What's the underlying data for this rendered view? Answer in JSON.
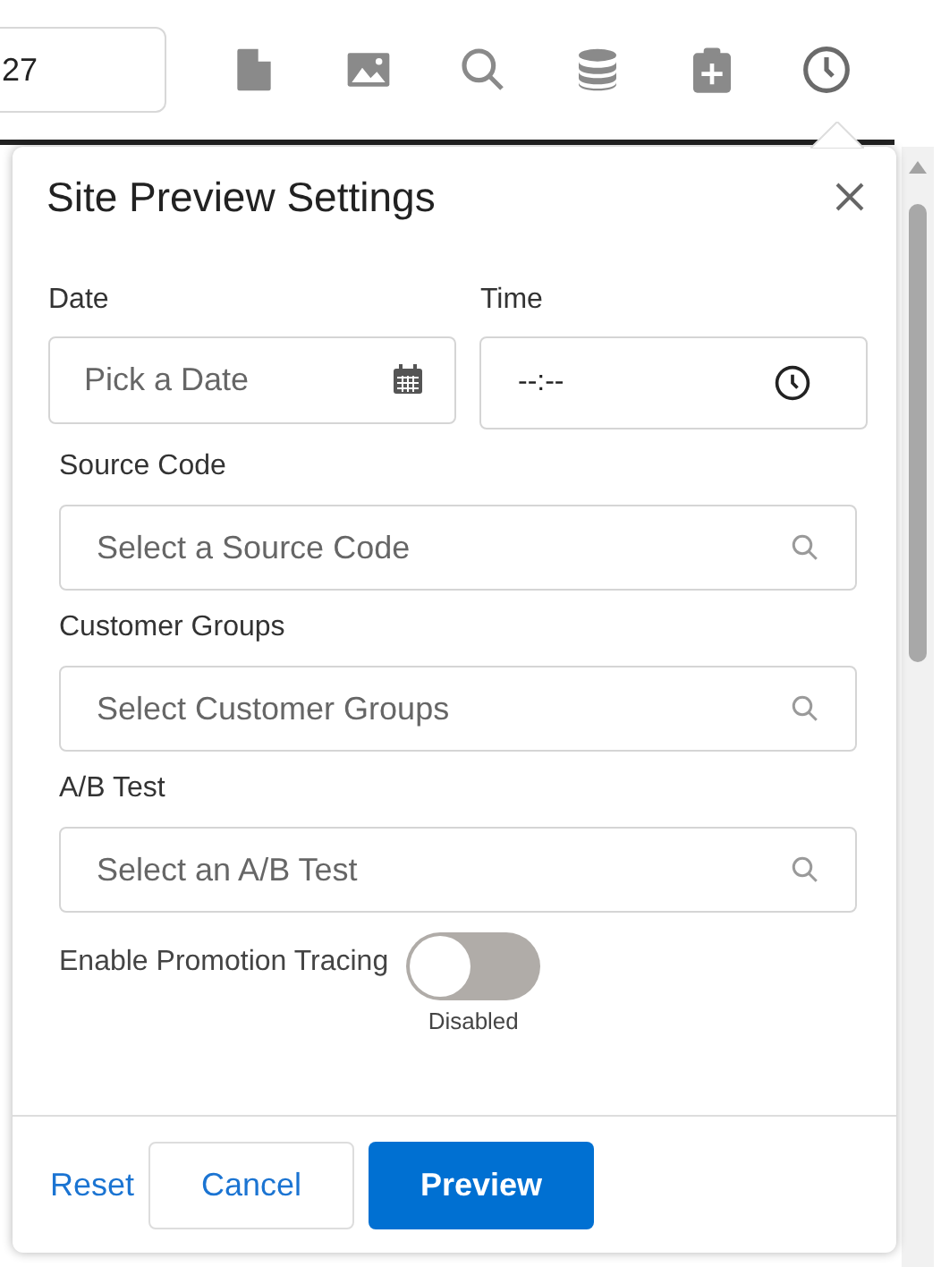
{
  "header": {
    "field_value": "27",
    "toolbar": [
      {
        "kind": "document"
      },
      {
        "kind": "image"
      },
      {
        "kind": "search"
      },
      {
        "kind": "database"
      },
      {
        "kind": "clipboard"
      },
      {
        "kind": "clock",
        "selected": true
      }
    ]
  },
  "popover": {
    "title": "Site Preview Settings",
    "date": {
      "label": "Date",
      "placeholder": "Pick a Date"
    },
    "time": {
      "label": "Time",
      "value": "--:--"
    },
    "fields": [
      {
        "label": "Source Code",
        "placeholder": "Select a Source Code"
      },
      {
        "label": "Customer Groups",
        "placeholder": "Select Customer Groups"
      },
      {
        "label": "A/B Test",
        "placeholder": "Select an A/B Test"
      }
    ],
    "toggle": {
      "label": "Enable Promotion Tracing",
      "on": false,
      "status": "Disabled"
    },
    "buttons": {
      "reset": "Reset",
      "cancel": "Cancel",
      "preview": "Preview"
    }
  }
}
